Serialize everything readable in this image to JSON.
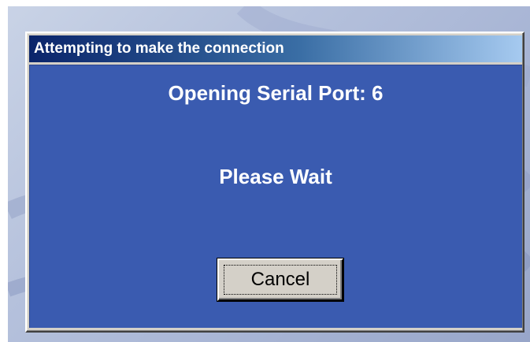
{
  "window": {
    "title": "Attempting to make the connection"
  },
  "message": {
    "status": "Opening Serial Port: 6",
    "wait": "Please Wait"
  },
  "buttons": {
    "cancel_label": "Cancel"
  },
  "colors": {
    "client_background": "#3a5bb0",
    "titlebar_start": "#0a246a",
    "titlebar_end": "#a6caf0",
    "text": "#ffffff"
  }
}
